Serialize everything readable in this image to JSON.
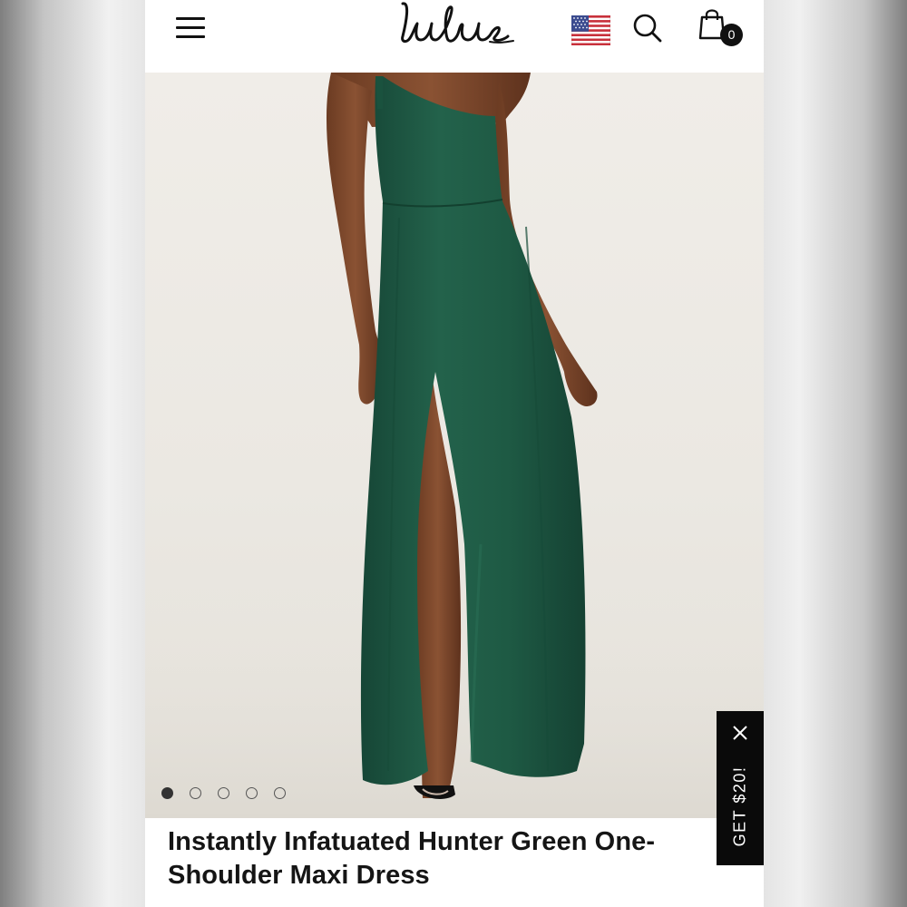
{
  "header": {
    "brand": "Lulus",
    "cart_count": "0"
  },
  "icons": {
    "menu": "hamburger-menu-icon",
    "flag": "us-flag-icon",
    "search": "search-icon",
    "cart": "shopping-bag-icon",
    "close": "close-icon"
  },
  "product": {
    "title_line1": "Instantly Infatuated Hunter Green One-",
    "title_line2": "Shoulder Maxi Dress",
    "dress_color": "#1f5a45"
  },
  "carousel": {
    "total_images": 5,
    "active_index": 0
  },
  "promo": {
    "label": "GET $20!"
  }
}
